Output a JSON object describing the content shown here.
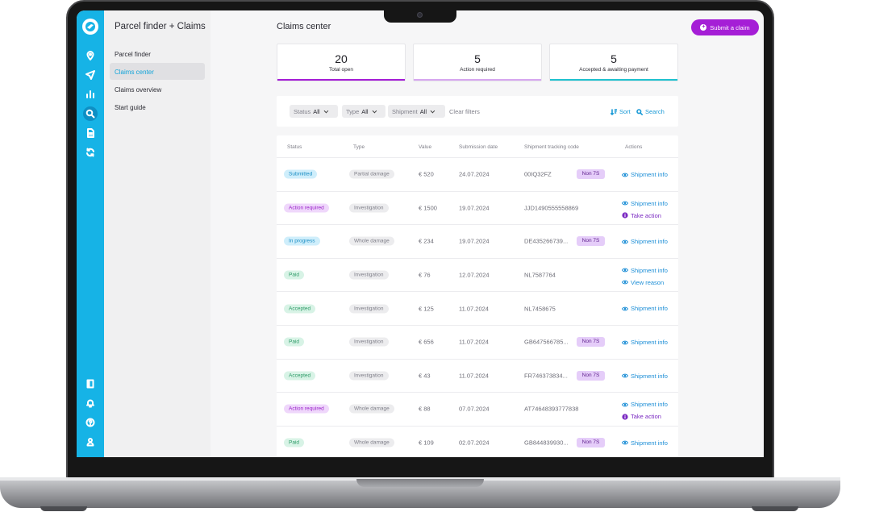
{
  "app": {
    "title": "Parcel finder + Claims"
  },
  "subnav": {
    "items": [
      {
        "label": "Parcel finder",
        "active": false
      },
      {
        "label": "Claims center",
        "active": true
      },
      {
        "label": "Claims overview",
        "active": false
      },
      {
        "label": "Start guide",
        "active": false
      }
    ]
  },
  "rail": {
    "top_icons": [
      "location-pin-icon",
      "send-icon",
      "bar-chart-icon",
      "search-icon",
      "document-icon",
      "refresh-icon"
    ],
    "bottom_icons": [
      "book-icon",
      "bell-icon",
      "help-icon",
      "user-icon"
    ],
    "active": "search-icon"
  },
  "page": {
    "title": "Claims center",
    "submit_label": "Submit a claim"
  },
  "stats": [
    {
      "value": "20",
      "label": "Total open",
      "color": "#a51ed6"
    },
    {
      "value": "5",
      "label": "Action required",
      "color": "#d7a7f0"
    },
    {
      "value": "5",
      "label": "Accepted & awaiting payment",
      "color": "#20c2cf"
    }
  ],
  "filters": {
    "status": {
      "label": "Status",
      "value": "All"
    },
    "type": {
      "label": "Type",
      "value": "All"
    },
    "shipment": {
      "label": "Shipment",
      "value": "All"
    },
    "clear_label": "Clear filters",
    "sort_label": "Sort",
    "search_label": "Search"
  },
  "table": {
    "headers": [
      "Status",
      "Type",
      "Value",
      "Submission date",
      "Shipment tracking code",
      "Actions"
    ],
    "rows": [
      {
        "status": "Submitted",
        "status_kind": "submitted",
        "type": "Partial damage",
        "value": "€ 520",
        "date": "24.07.2024",
        "code": "00IQ32FZ",
        "badge": "Non 7S",
        "actions": [
          "Shipment info"
        ]
      },
      {
        "status": "Action required",
        "status_kind": "action",
        "type": "Investigation",
        "value": "€ 1500",
        "date": "19.07.2024",
        "code": "JJD1490555558869",
        "badge": "",
        "actions": [
          "Shipment info",
          "Take action"
        ]
      },
      {
        "status": "In progress",
        "status_kind": "progress",
        "type": "Whole damage",
        "value": "€ 234",
        "date": "19.07.2024",
        "code": "DE435266739...",
        "badge": "Non 7S",
        "actions": [
          "Shipment info"
        ]
      },
      {
        "status": "Paid",
        "status_kind": "paid",
        "type": "Investigation",
        "value": "€ 76",
        "date": "12.07.2024",
        "code": "NL7587764",
        "badge": "",
        "actions": [
          "Shipment info",
          "View reason"
        ]
      },
      {
        "status": "Accepted",
        "status_kind": "accepted",
        "type": "Investigation",
        "value": "€ 125",
        "date": "11.07.2024",
        "code": "NL7458675",
        "badge": "",
        "actions": [
          "Shipment info"
        ]
      },
      {
        "status": "Paid",
        "status_kind": "paid",
        "type": "Investigation",
        "value": "€ 656",
        "date": "11.07.2024",
        "code": "GB647566785...",
        "badge": "Non 7S",
        "actions": [
          "Shipment info"
        ]
      },
      {
        "status": "Accepted",
        "status_kind": "accepted",
        "type": "Investigation",
        "value": "€ 43",
        "date": "11.07.2024",
        "code": "FR746373834...",
        "badge": "Non 7S",
        "actions": [
          "Shipment info"
        ]
      },
      {
        "status": "Action required",
        "status_kind": "action",
        "type": "Whole damage",
        "value": "€ 88",
        "date": "07.07.2024",
        "code": "AT74648393777838",
        "badge": "",
        "actions": [
          "Shipment info",
          "Take action"
        ]
      },
      {
        "status": "Paid",
        "status_kind": "paid",
        "type": "Whole damage",
        "value": "€ 109",
        "date": "02.07.2024",
        "code": "GB844839930...",
        "badge": "Non 7S",
        "actions": [
          "Shipment info"
        ]
      }
    ]
  }
}
